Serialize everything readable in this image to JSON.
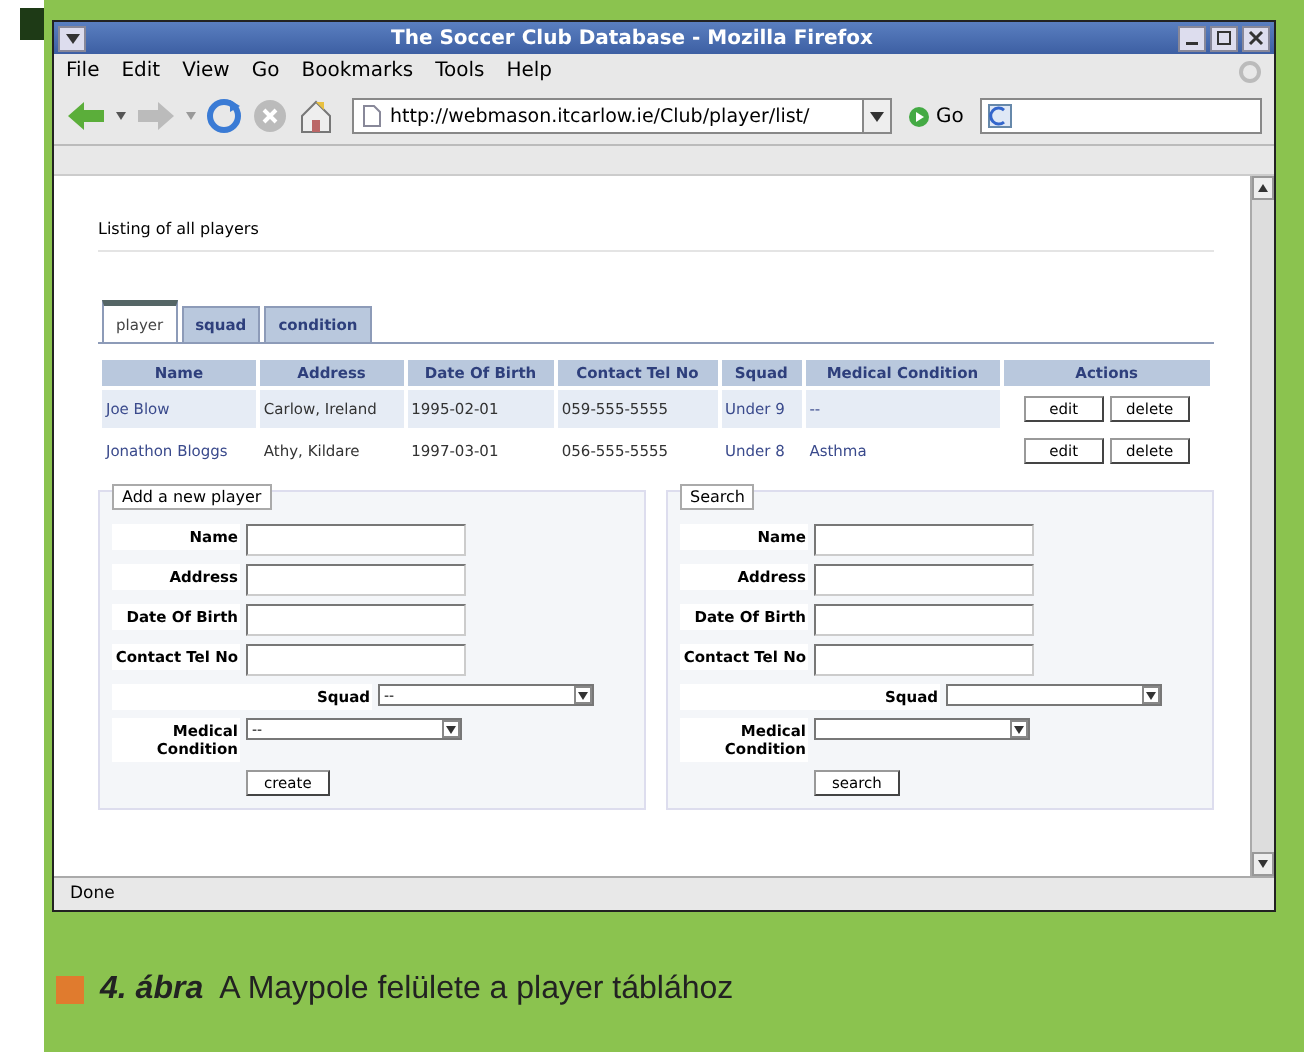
{
  "window": {
    "title": "The Soccer Club Database - Mozilla Firefox"
  },
  "menu": [
    "File",
    "Edit",
    "View",
    "Go",
    "Bookmarks",
    "Tools",
    "Help"
  ],
  "toolbar": {
    "url": "http://webmason.itcarlow.ie/Club/player/list/",
    "go": "Go"
  },
  "page": {
    "heading": "Listing of all players",
    "tabs": [
      {
        "label": "player",
        "selected": true
      },
      {
        "label": "squad",
        "selected": false
      },
      {
        "label": "condition",
        "selected": false
      }
    ],
    "table": {
      "columns": [
        "Name",
        "Address",
        "Date Of Birth",
        "Contact Tel No",
        "Squad",
        "Medical Condition",
        "Actions"
      ],
      "rows": [
        {
          "highlighted": true,
          "cells": [
            "Joe Blow",
            "Carlow, Ireland",
            "1995-02-01",
            "059-555-5555",
            "Under 9",
            "--"
          ],
          "actions": [
            "edit",
            "delete"
          ]
        },
        {
          "highlighted": false,
          "cells": [
            "Jonathon Bloggs",
            "Athy, Kildare",
            "1997-03-01",
            "056-555-5555",
            "Under 8",
            "Asthma"
          ],
          "actions": [
            "edit",
            "delete"
          ]
        }
      ]
    },
    "forms": [
      {
        "legend": "Add a new player",
        "button": "create",
        "fields": [
          {
            "kind": "text",
            "label": "Name"
          },
          {
            "kind": "text",
            "label": "Address"
          },
          {
            "kind": "text",
            "label": "Date Of Birth"
          },
          {
            "kind": "text",
            "label": "Contact Tel No"
          },
          {
            "kind": "wide-select",
            "label": "Squad",
            "value": "--"
          },
          {
            "kind": "select",
            "label": "Medical Condition",
            "value": "--"
          }
        ]
      },
      {
        "legend": "Search",
        "button": "search",
        "fields": [
          {
            "kind": "text",
            "label": "Name"
          },
          {
            "kind": "text",
            "label": "Address"
          },
          {
            "kind": "text",
            "label": "Date Of Birth"
          },
          {
            "kind": "text",
            "label": "Contact Tel No"
          },
          {
            "kind": "wide-select",
            "label": "Squad"
          },
          {
            "kind": "select",
            "label": "Medical Condition"
          }
        ]
      }
    ]
  },
  "status_bar": "Done",
  "caption": {
    "number": "4. ábra",
    "text": "A Maypole felülete a player táblához"
  }
}
